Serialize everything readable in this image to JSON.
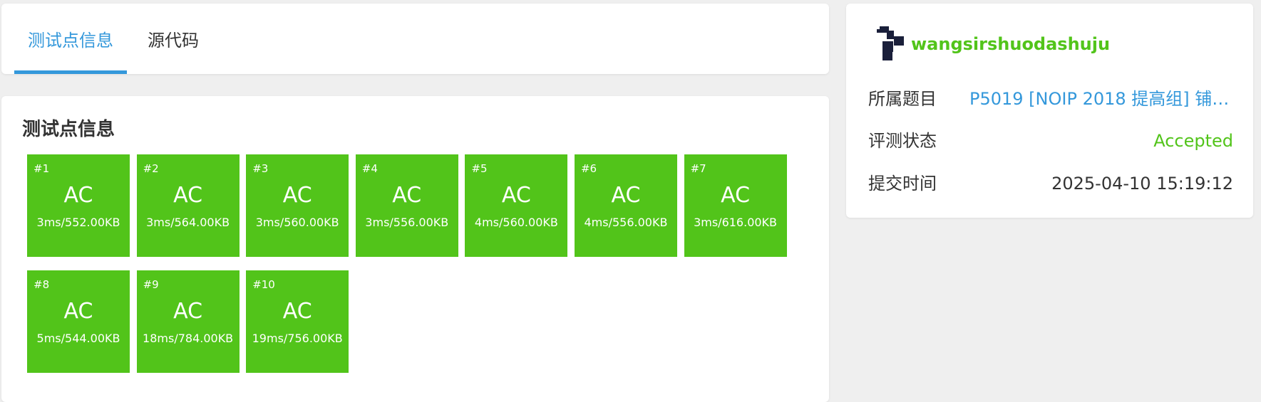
{
  "tabs": [
    {
      "label": "测试点信息",
      "active": true
    },
    {
      "label": "源代码",
      "active": false
    }
  ],
  "testcases": {
    "title": "测试点信息",
    "status_color": "#52c41a",
    "items": [
      {
        "id": "#1",
        "status": "AC",
        "meta": "3ms/552.00KB"
      },
      {
        "id": "#2",
        "status": "AC",
        "meta": "3ms/564.00KB"
      },
      {
        "id": "#3",
        "status": "AC",
        "meta": "3ms/560.00KB"
      },
      {
        "id": "#4",
        "status": "AC",
        "meta": "3ms/556.00KB"
      },
      {
        "id": "#5",
        "status": "AC",
        "meta": "4ms/560.00KB"
      },
      {
        "id": "#6",
        "status": "AC",
        "meta": "4ms/556.00KB"
      },
      {
        "id": "#7",
        "status": "AC",
        "meta": "3ms/616.00KB"
      },
      {
        "id": "#8",
        "status": "AC",
        "meta": "5ms/544.00KB"
      },
      {
        "id": "#9",
        "status": "AC",
        "meta": "18ms/784.00KB"
      },
      {
        "id": "#10",
        "status": "AC",
        "meta": "19ms/756.00KB"
      }
    ]
  },
  "info": {
    "avatar_icon": "user-avatar-icon",
    "username": "wangsirshuodashuju",
    "problem_label": "所属题目",
    "problem_value": "P5019 [NOIP 2018 提高组] 铺设...",
    "status_label": "评测状态",
    "status_value": "Accepted",
    "time_label": "提交时间",
    "time_value": "2025-04-10 15:19:12"
  },
  "colors": {
    "accent": "#3498db",
    "success": "#52c41a",
    "page_bg": "#efefef"
  }
}
